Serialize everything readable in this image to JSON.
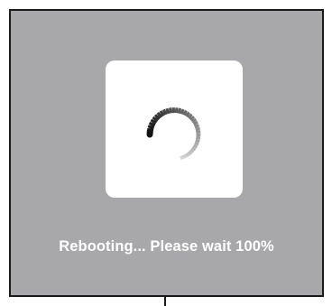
{
  "dialog": {
    "status_message": "Rebooting... Please wait 100%",
    "progress_percent": 100,
    "spinner_icon": "loading-spinner-icon"
  },
  "colors": {
    "overlay": "#a8a8aa",
    "card": "#ffffff",
    "text": "#ffffff",
    "spinner_dark": "#111111",
    "spinner_light": "#d0d0d0"
  }
}
